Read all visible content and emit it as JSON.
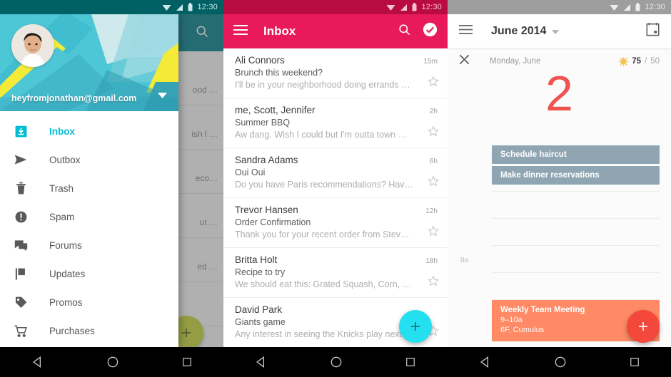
{
  "status_bar": {
    "time": "12:30",
    "icons": [
      "wifi-icon",
      "signal-icon",
      "battery-icon"
    ]
  },
  "nav_bar": {
    "back": "back-icon",
    "home": "home-icon",
    "recents": "recents-icon"
  },
  "colors": {
    "teal_appbar": "#00838f",
    "pink_appbar": "#e81a5b",
    "drawer_header_teal": "#4dc6d6",
    "drawer_active": "#00bcd4",
    "fab_lime": "#cddc39",
    "fab_cyan": "#24dff0",
    "fab_red": "#f4483c",
    "task_slate": "#8fa6b2",
    "event_coral": "#ff8a65",
    "big_date_red": "#ef5350"
  },
  "screen_drawer": {
    "search_icon": "search-icon",
    "account": {
      "email": "heyfromjonathan@gmail.com",
      "avatar": "user-avatar",
      "caret": "chevron-down-icon"
    },
    "items": [
      {
        "label": "Inbox",
        "icon": "inbox-icon",
        "active": true
      },
      {
        "label": "Outbox",
        "icon": "send-icon",
        "active": false
      },
      {
        "label": "Trash",
        "icon": "trash-icon",
        "active": false
      },
      {
        "label": "Spam",
        "icon": "alert-icon",
        "active": false
      },
      {
        "label": "Forums",
        "icon": "forum-icon",
        "active": false
      },
      {
        "label": "Updates",
        "icon": "flag-icon",
        "active": false
      },
      {
        "label": "Promos",
        "icon": "tag-icon",
        "active": false
      },
      {
        "label": "Purchases",
        "icon": "cart-icon",
        "active": false
      }
    ],
    "background_list_fragments": [
      "ood …",
      "ish l …",
      "eco…",
      "ut …",
      "ed …"
    ],
    "fab": {
      "icon": "plus-icon",
      "label": "+"
    }
  },
  "screen_inbox": {
    "title": "Inbox",
    "menu_icon": "hamburger-icon",
    "search_icon": "search-icon",
    "check_icon": "check-circle-icon",
    "messages": [
      {
        "from": "Ali Connors",
        "subject": "Brunch this weekend?",
        "snippet": "I'll be in your neighborhood doing errands …",
        "time": "15m",
        "star": "star-outline-icon"
      },
      {
        "from": "me, Scott, Jennifer",
        "subject": "Summer BBQ",
        "snippet": "Aw dang. Wish I could but I'm outta town …",
        "time": "2h",
        "star": "star-outline-icon"
      },
      {
        "from": "Sandra Adams",
        "subject": "Oui Oui",
        "snippet": "Do you have Paris recommendations? Hav…",
        "time": "6h",
        "star": "star-outline-icon"
      },
      {
        "from": "Trevor Hansen",
        "subject": "Order Confirmation",
        "snippet": "Thank you for your recent order from Stev…",
        "time": "12h",
        "star": "star-outline-icon"
      },
      {
        "from": "Britta Holt",
        "subject": "Recipe to try",
        "snippet": "We should eat this: Grated Squash, Corn, …",
        "time": "18h",
        "star": "star-outline-icon"
      },
      {
        "from": "David Park",
        "subject": "Giants game",
        "snippet": "Any interest in seeing the Knicks play next …",
        "time": "",
        "star": "star-outline-icon"
      }
    ],
    "fab": {
      "icon": "plus-icon",
      "label": "+"
    }
  },
  "screen_calendar": {
    "title": "June 2014",
    "menu_icon": "hamburger-icon",
    "caret_icon": "chevron-down-icon",
    "calendar_icon": "calendar-icon",
    "day_bar": {
      "close_icon": "close-icon",
      "day_label": "Monday, June",
      "weather_icon": "sun-icon",
      "high": "75",
      "separator": "/",
      "low": "50"
    },
    "big_date": "2",
    "tasks": [
      "Schedule haircut",
      "Make dinner reservations"
    ],
    "hour_label": "8a",
    "event": {
      "title": "Weekly Team Meeting",
      "time": "9–10a",
      "location": "6F, Cumulus"
    },
    "fab": {
      "icon": "plus-icon",
      "label": "+"
    }
  }
}
